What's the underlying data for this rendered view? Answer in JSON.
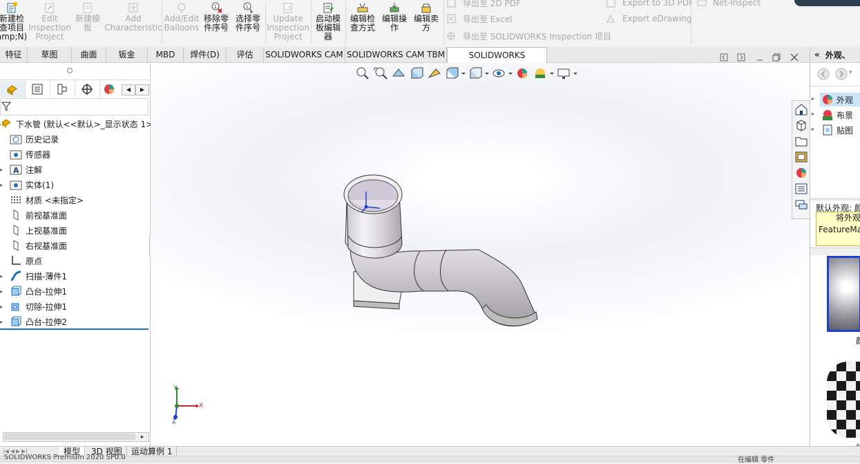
{
  "ribbon": {
    "new_check_project": "新建检\n查项目\namp;N)",
    "edit_inspection_project": "Edit\nInspection\nProject",
    "new_template": "新建模\n板",
    "add_characteristic": "Add\nCharacteristic",
    "add_edit_balloons": "Add/Edit\nBalloons",
    "remove_part_number": "移除零\n件序号",
    "select_part_number": "选择零\n件序号",
    "update_inspection_project": "Update\nInspection\nProject",
    "launch_template_editor": "启动模\n板编辑\n器",
    "edit_check_method": "编辑检\n查方式",
    "edit_operation": "编辑操\n作",
    "edit_vendor": "编辑卖\n方",
    "export_2d_pdf": "导出至 2D PDF",
    "export_excel": "导出至 Excel",
    "export_sw_inspection": "导出至 SOLIDWORKS Inspection 项目",
    "export_3d_pdf": "Export to 3D PDF",
    "export_edrawing": "Export eDrawing",
    "net_inspect": "Net-Inspect"
  },
  "tabs": [
    "特征",
    "草图",
    "曲面",
    "钣金",
    "MBD",
    "焊件(D)",
    "评估",
    "SOLIDWORKS CAM",
    "SOLIDWORKS CAM TBM",
    "SOLIDWORKS Inspection"
  ],
  "active_tab": "SOLIDWORKS Inspection",
  "tree": {
    "root": "下水管  (默认<<默认>_显示状态 1>)",
    "items": [
      "历史记录",
      "传感器",
      "注解",
      "实体(1)",
      "材质 <未指定>",
      "前视基准面",
      "上视基准面",
      "右视基准面",
      "原点",
      "扫描-薄件1",
      "凸台-拉伸1",
      "切除-拉伸1",
      "凸台-拉伸2"
    ]
  },
  "triad": {
    "x": "X",
    "y": "Y",
    "z": "Z"
  },
  "right_panel": {
    "header": "外观、",
    "tree": [
      "外观",
      "布景",
      "贴图"
    ],
    "default_label": "默认外观: 颜",
    "tooltip_line1": "将外观",
    "tooltip_line2": "FeatureMa",
    "thumb1_label": "颜",
    "thumb2_label": "纹"
  },
  "bottom_tabs": [
    "模型",
    "3D 视图",
    "运动算例 1"
  ],
  "status": {
    "left": "SOLIDWORKS Premium 2020 SP0.0",
    "right": "在编辑 零件"
  },
  "colors": {
    "accent": "#1e6fc0",
    "tooltip": "#ffffc6",
    "active_tab": "#ffffff",
    "part": "#d8d8dc"
  }
}
